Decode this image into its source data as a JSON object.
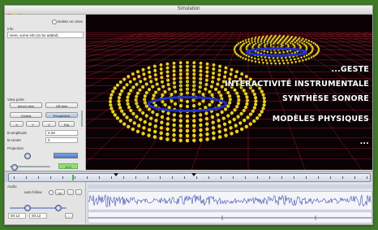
{
  "window": {
    "title": "Simulation"
  },
  "left_panel": {
    "delete_on_close": "Delete on close",
    "info_label": "Info",
    "info_text": "Here, some info (to be added)",
    "view_point": {
      "label": "View point",
      "buttons": [
        "bench view",
        "Off view"
      ],
      "mode_buttons": [
        "Gimbal",
        "Perspective"
      ],
      "small_buttons": [
        "X",
        "Y",
        "Z",
        "Rot"
      ],
      "fields": [
        {
          "label": "B-amplitude",
          "value": "0.28"
        },
        {
          "label": "B-center",
          "value": "0"
        }
      ]
    },
    "projection_label": "Projection",
    "gauge_value": "10.0"
  },
  "overlay_lines": [
    "...GESTE",
    "INTERACTIVITÉ INSTRUMENTALE",
    "SYNTHÈSE SONORE",
    "MODÈLES PHYSIQUES",
    "..."
  ],
  "audio": {
    "label": "Audio",
    "auto_follow": "auto follow",
    "button_1x": "1x",
    "time_start": "00:12",
    "time_end": "00:12"
  },
  "colors": {
    "desktop_bg": "#3f7b27",
    "sphere_color": "#e8d021",
    "grid_color": "#b5232f",
    "disc_color": "#2230c8"
  }
}
